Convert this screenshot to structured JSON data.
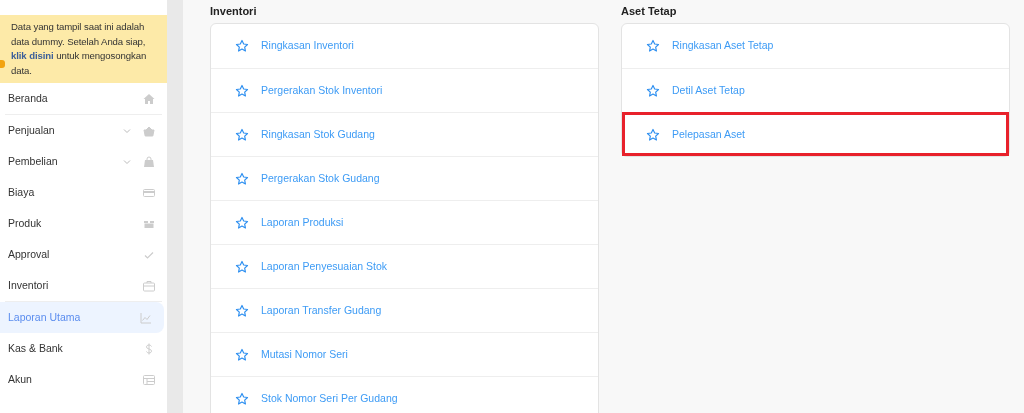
{
  "notice": {
    "text_before": "Data yang tampil saat ini adalah data dummy. Setelah Anda siap,",
    "link": "klik disini",
    "text_after": "untuk mengosongkan data."
  },
  "sidebar": {
    "items": [
      {
        "label": "Beranda",
        "expandable": false,
        "selected": false
      },
      {
        "label": "Penjualan",
        "expandable": true,
        "selected": false
      },
      {
        "label": "Pembelian",
        "expandable": true,
        "selected": false
      },
      {
        "label": "Biaya",
        "expandable": false,
        "selected": false
      },
      {
        "label": "Produk",
        "expandable": false,
        "selected": false
      },
      {
        "label": "Approval",
        "expandable": false,
        "selected": false
      },
      {
        "label": "Inventori",
        "expandable": false,
        "selected": false
      },
      {
        "label": "Laporan Utama",
        "expandable": false,
        "selected": true
      },
      {
        "label": "Kas & Bank",
        "expandable": false,
        "selected": false
      },
      {
        "label": "Akun",
        "expandable": false,
        "selected": false
      }
    ]
  },
  "sections": [
    {
      "title": "Inventori",
      "reports": [
        {
          "label": "Ringkasan Inventori",
          "highlighted": false
        },
        {
          "label": "Pergerakan Stok Inventori",
          "highlighted": false
        },
        {
          "label": "Ringkasan Stok Gudang",
          "highlighted": false
        },
        {
          "label": "Pergerakan Stok Gudang",
          "highlighted": false
        },
        {
          "label": "Laporan Produksi",
          "highlighted": false
        },
        {
          "label": "Laporan Penyesuaian Stok",
          "highlighted": false
        },
        {
          "label": "Laporan Transfer Gudang",
          "highlighted": false
        },
        {
          "label": "Mutasi Nomor Seri",
          "highlighted": false
        },
        {
          "label": "Stok Nomor Seri Per Gudang",
          "highlighted": false
        }
      ]
    },
    {
      "title": "Aset Tetap",
      "reports": [
        {
          "label": "Ringkasan Aset Tetap",
          "highlighted": false
        },
        {
          "label": "Detil Aset Tetap",
          "highlighted": false
        },
        {
          "label": "Pelepasan Aset",
          "highlighted": true
        }
      ]
    }
  ]
}
